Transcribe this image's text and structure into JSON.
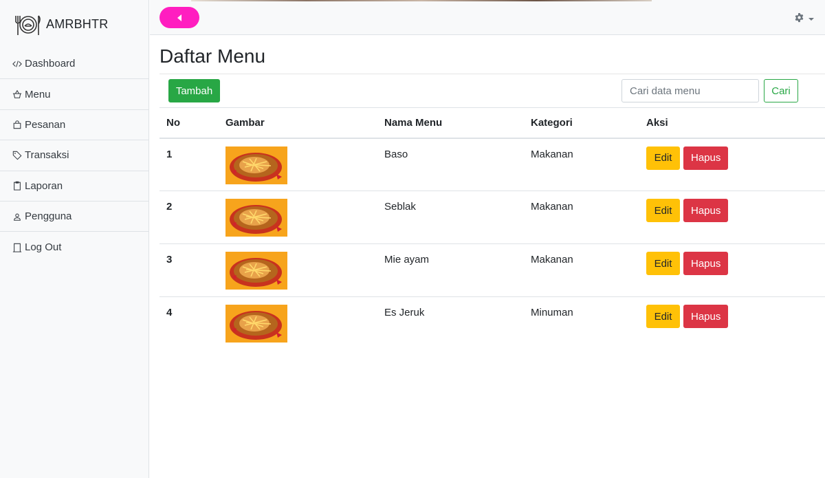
{
  "brand": {
    "name": "AMRBHTR",
    "logo_icon": "plate-fork-knife-icon"
  },
  "sidebar": {
    "items": [
      {
        "label": "Dashboard",
        "icon": "code-icon"
      },
      {
        "label": "Menu",
        "icon": "basket-icon"
      },
      {
        "label": "Pesanan",
        "icon": "bag-icon"
      },
      {
        "label": "Transaksi",
        "icon": "tag-icon"
      },
      {
        "label": "Laporan",
        "icon": "clipboard-icon"
      },
      {
        "label": "Pengguna",
        "icon": "person-icon"
      },
      {
        "label": "Log Out",
        "icon": "door-icon"
      }
    ]
  },
  "topbar": {
    "toggle_icon": "caret-left-icon",
    "settings_icon": "gear-icon",
    "toggle_color": "#ff1ec0"
  },
  "page": {
    "title": "Daftar Menu"
  },
  "toolbar": {
    "add_label": "Tambah",
    "search_placeholder": "Cari data menu",
    "search_value": "",
    "search_button": "Cari"
  },
  "table": {
    "headers": {
      "no": "No",
      "gambar": "Gambar",
      "nama": "Nama Menu",
      "kategori": "Kategori",
      "aksi": "Aksi"
    },
    "rows": [
      {
        "no": "1",
        "nama": "Baso",
        "kategori": "Makanan"
      },
      {
        "no": "2",
        "nama": "Seblak",
        "kategori": "Makanan"
      },
      {
        "no": "3",
        "nama": "Mie ayam",
        "kategori": "Makanan"
      },
      {
        "no": "4",
        "nama": "Es Jeruk",
        "kategori": "Minuman"
      }
    ],
    "edit_label": "Edit",
    "delete_label": "Hapus"
  },
  "colors": {
    "success": "#28a745",
    "warning": "#ffc107",
    "danger": "#dc3545"
  }
}
